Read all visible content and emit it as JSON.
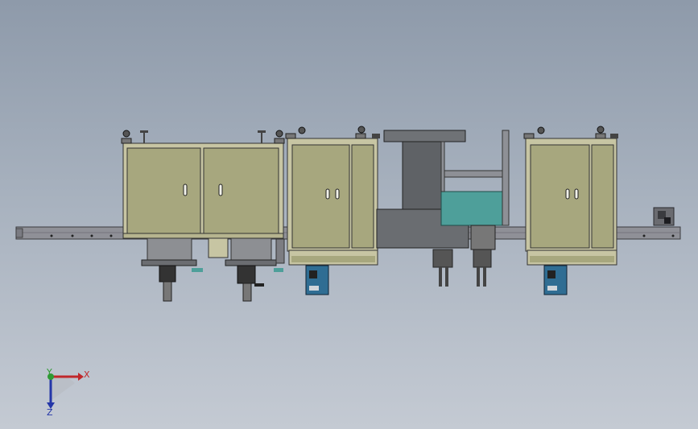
{
  "triad": {
    "x_label": "X",
    "y_label": "Y",
    "z_label": "Z"
  },
  "colors": {
    "cabinet_fill": "#a7a77e",
    "cabinet_frame": "#c9c7a5",
    "frame_rail": "#8e8e96",
    "cylinder_gray": "#6f7276",
    "tank_teal": "#4e9f9a",
    "motor_blue": "#2f6d93",
    "x_axis": "#c0282b",
    "y_axis": "#2e9a33",
    "z_axis": "#2436a8"
  }
}
